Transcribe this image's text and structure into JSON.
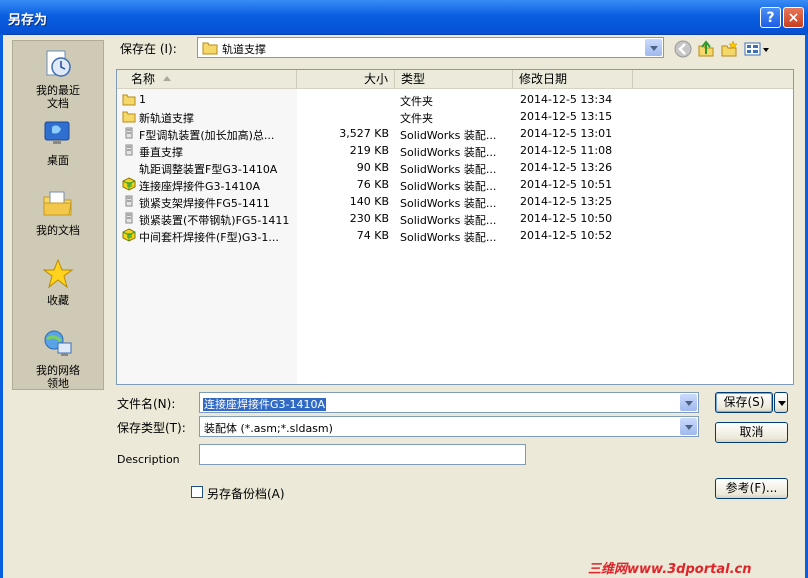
{
  "window": {
    "title": "另存为",
    "help_glyph": "?",
    "close_glyph": "×"
  },
  "places": [
    {
      "label": "我的最近\n文档",
      "icon": "recent-documents-icon"
    },
    {
      "label": "桌面",
      "icon": "desktop-icon"
    },
    {
      "label": "我的文档",
      "icon": "my-documents-icon"
    },
    {
      "label": "收藏",
      "icon": "favorites-star-icon"
    },
    {
      "label": "我的网络\n领地",
      "icon": "network-places-icon"
    }
  ],
  "save_in": {
    "label": "保存在 (I):",
    "value": "轨道支撑"
  },
  "columns": {
    "name": "名称",
    "size": "大小",
    "type": "类型",
    "modified": "修改日期"
  },
  "files": [
    {
      "name": "1",
      "size": "",
      "type": "文件夹",
      "modified": "2014-12-5 13:34",
      "icon": "folder"
    },
    {
      "name": "新轨道支撑",
      "size": "",
      "type": "文件夹",
      "modified": "2014-12-5 13:15",
      "icon": "folder"
    },
    {
      "name": "F型调轨装置(加长加高)总...",
      "size": "3,527 KB",
      "type": "SolidWorks 装配...",
      "modified": "2014-12-5 13:01",
      "icon": "part"
    },
    {
      "name": "垂直支撑",
      "size": "219 KB",
      "type": "SolidWorks 装配...",
      "modified": "2014-12-5 11:08",
      "icon": "part"
    },
    {
      "name": "轨距调整装置F型G3-1410A",
      "size": "90 KB",
      "type": "SolidWorks 装配...",
      "modified": "2014-12-5 13:26",
      "icon": "blank"
    },
    {
      "name": "连接座焊接件G3-1410A",
      "size": "76 KB",
      "type": "SolidWorks 装配...",
      "modified": "2014-12-5 10:51",
      "icon": "assembly"
    },
    {
      "name": "锁紧支架焊接件FG5-1411",
      "size": "140 KB",
      "type": "SolidWorks 装配...",
      "modified": "2014-12-5 13:25",
      "icon": "part"
    },
    {
      "name": "锁紧装置(不带钢轨)FG5-1411",
      "size": "230 KB",
      "type": "SolidWorks 装配...",
      "modified": "2014-12-5 10:50",
      "icon": "part"
    },
    {
      "name": "中间套杆焊接件(F型)G3-1...",
      "size": "74 KB",
      "type": "SolidWorks 装配...",
      "modified": "2014-12-5 10:52",
      "icon": "assembly"
    }
  ],
  "filename": {
    "label": "文件名(N):",
    "value": "连接座焊接件G3-1410A"
  },
  "filetype": {
    "label": "保存类型(T):",
    "value": "装配体 (*.asm;*.sldasm)"
  },
  "description": {
    "label": "Description",
    "value": ""
  },
  "backup": {
    "label": "另存备份档(A)",
    "checked": false
  },
  "buttons": {
    "save": "保存(S)",
    "cancel": "取消",
    "reference": "参考(F)..."
  },
  "watermark": "三维网www.3dportal.cn",
  "colors": {
    "titlebar": "#0a5fe0",
    "selection": "#316ac5",
    "dialog_bg": "#ece9d8",
    "watermark": "#e0242a"
  }
}
